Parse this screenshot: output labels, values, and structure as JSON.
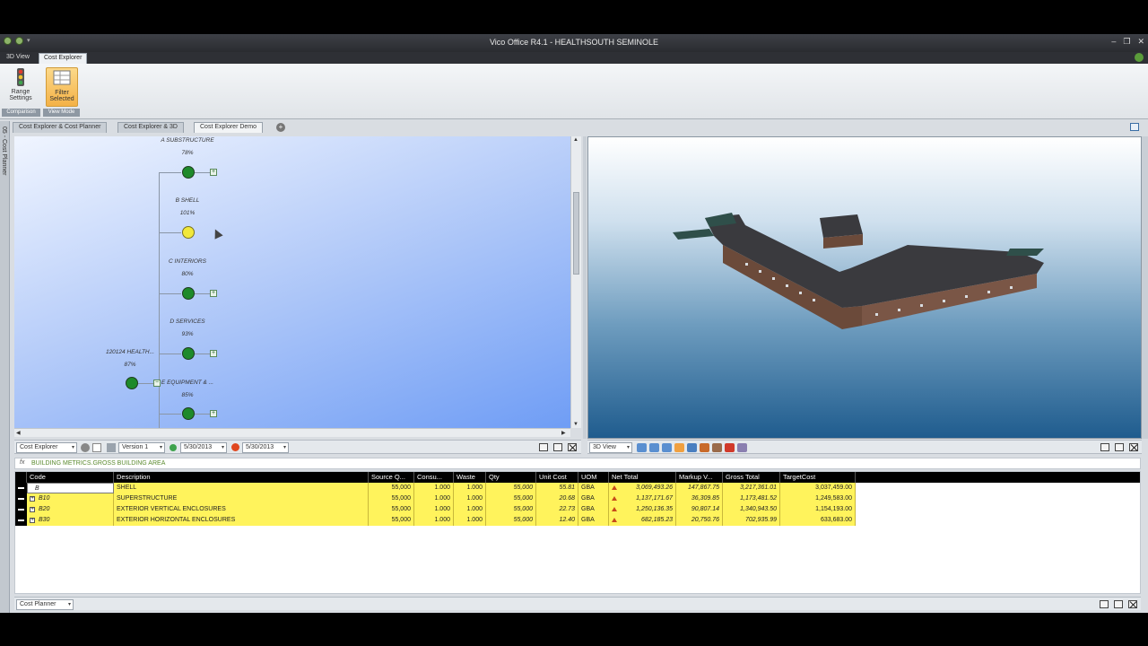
{
  "window": {
    "title": "Vico Office R4.1 - HEALTHSOUTH SEMINOLE",
    "controls": {
      "minimize": "–",
      "restore": "❐",
      "close": "✕"
    }
  },
  "ribbon_tabs": [
    "3D View",
    "Cost Explorer"
  ],
  "ribbon": {
    "range_settings": "Range Settings",
    "filter_selected": "Filter Selected",
    "group_comparison": "Comparison",
    "group_view_mode": "View Mode"
  },
  "doc_tabs": [
    "Cost Explorer & Cost Planner",
    "Cost Explorer & 3D",
    "Cost Explorer Demo"
  ],
  "side_strip": "05 - Cost Planner",
  "tree": {
    "root": {
      "label": "120124 HEALTH...",
      "pct": "87%"
    },
    "nodes": [
      {
        "label": "A SUBSTRUCTURE",
        "pct": "78%"
      },
      {
        "label": "B SHELL",
        "pct": "101%"
      },
      {
        "label": "C INTERIORS",
        "pct": "80%"
      },
      {
        "label": "D SERVICES",
        "pct": "93%"
      },
      {
        "label": "E EQUIPMENT & ...",
        "pct": "85%"
      }
    ],
    "colors": {
      "green": "#1e8a2a",
      "yellow": "#f1e83a"
    }
  },
  "explorer_toolbar": {
    "view_select": "Cost Explorer",
    "version_select": "Version 1",
    "date_start": "5/30/2013",
    "date_end": "5/30/2013"
  },
  "view3d_toolbar": {
    "view_select": "3D View"
  },
  "formula_bar": {
    "fx": "fx",
    "text": "BUILDING METRICS.GROSS BUILDING AREA"
  },
  "grid": {
    "columns": [
      "Code",
      "Description",
      "Source Q...",
      "Consu...",
      "Waste",
      "Qty",
      "Unit Cost",
      "UOM",
      "Net Total",
      "Markup V...",
      "Gross Total",
      "TargetCost"
    ],
    "rows": [
      {
        "code": "B",
        "desc": "SHELL",
        "source": "55,000",
        "consu": "1.000",
        "waste": "1.000",
        "qty": "55,000",
        "unit": "55.81",
        "uom": "GBA",
        "net": "3,069,493.26",
        "markup": "147,867.75",
        "gross": "3,217,361.01",
        "target": "3,037,459.00"
      },
      {
        "code": "B10",
        "desc": "SUPERSTRUCTURE",
        "source": "55,000",
        "consu": "1.000",
        "waste": "1.000",
        "qty": "55,000",
        "unit": "20.68",
        "uom": "GBA",
        "net": "1,137,171.67",
        "markup": "36,309.85",
        "gross": "1,173,481.52",
        "target": "1,249,583.00"
      },
      {
        "code": "B20",
        "desc": "EXTERIOR VERTICAL ENCLOSURES",
        "source": "55,000",
        "consu": "1.000",
        "waste": "1.000",
        "qty": "55,000",
        "unit": "22.73",
        "uom": "GBA",
        "net": "1,250,136.35",
        "markup": "90,807.14",
        "gross": "1,340,943.50",
        "target": "1,154,193.00"
      },
      {
        "code": "B30",
        "desc": "EXTERIOR HORIZONTAL ENCLOSURES",
        "source": "55,000",
        "consu": "1.000",
        "waste": "1.000",
        "qty": "55,000",
        "unit": "12.40",
        "uom": "GBA",
        "net": "682,185.23",
        "markup": "20,750.76",
        "gross": "702,935.99",
        "target": "633,683.00"
      }
    ]
  },
  "bottom_bar": {
    "view_select": "Cost Planner"
  }
}
